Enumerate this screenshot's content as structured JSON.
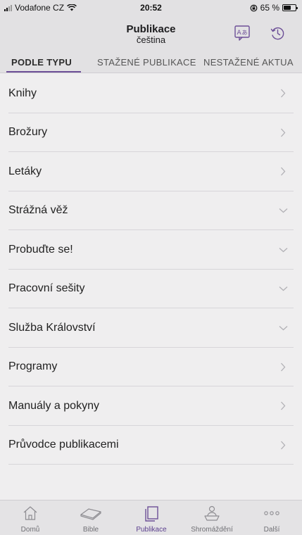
{
  "status_bar": {
    "carrier": "Vodafone CZ",
    "time": "20:52",
    "battery_text": "65 %",
    "battery_level": 0.65
  },
  "header": {
    "title": "Publikace",
    "subtitle": "čeština",
    "language_icon": "translate-icon",
    "history_icon": "history-icon"
  },
  "tabs": [
    {
      "label": "PODLE TYPU",
      "active": true
    },
    {
      "label": "STAŽENÉ PUBLIKACE",
      "active": false
    },
    {
      "label": "NESTAŽENÉ AKTUA",
      "active": false
    }
  ],
  "list": [
    {
      "label": "Knihy",
      "chevron": "right"
    },
    {
      "label": "Brožury",
      "chevron": "right"
    },
    {
      "label": "Letáky",
      "chevron": "right"
    },
    {
      "label": "Strážná věž",
      "chevron": "down"
    },
    {
      "label": "Probuďte se!",
      "chevron": "down"
    },
    {
      "label": "Pracovní sešity",
      "chevron": "down"
    },
    {
      "label": "Služba Království",
      "chevron": "down"
    },
    {
      "label": "Programy",
      "chevron": "right"
    },
    {
      "label": "Manuály a pokyny",
      "chevron": "right"
    },
    {
      "label": "Průvodce publikacemi",
      "chevron": "right"
    }
  ],
  "bottom_nav": [
    {
      "label": "Domů",
      "icon": "home-icon",
      "active": false
    },
    {
      "label": "Bible",
      "icon": "bible-icon",
      "active": false
    },
    {
      "label": "Publikace",
      "icon": "publications-icon",
      "active": true
    },
    {
      "label": "Shromáždění",
      "icon": "meetings-icon",
      "active": false
    },
    {
      "label": "Další",
      "icon": "more-icon",
      "active": false
    }
  ],
  "colors": {
    "accent": "#6c4f97",
    "background": "#efeeef",
    "bar_background": "#e2e1e3"
  }
}
